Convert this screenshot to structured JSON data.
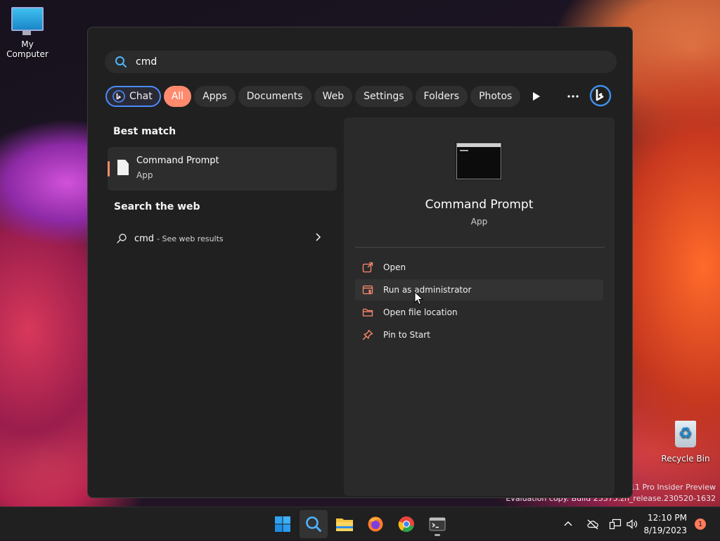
{
  "desktop": {
    "icons": [
      {
        "label": "My Computer"
      },
      {
        "label": "Recycle Bin"
      }
    ],
    "watermark": {
      "line1": "11 Pro Insider Preview",
      "line2": "Evaluation copy. Build 25375.zn_release.230520-1632"
    }
  },
  "search": {
    "query": "cmd",
    "filters": [
      {
        "label": "Chat"
      },
      {
        "label": "All"
      },
      {
        "label": "Apps"
      },
      {
        "label": "Documents"
      },
      {
        "label": "Web"
      },
      {
        "label": "Settings"
      },
      {
        "label": "Folders"
      },
      {
        "label": "Photos"
      }
    ],
    "best_match_heading": "Best match",
    "best_match": {
      "title": "Command Prompt",
      "subtitle": "App"
    },
    "web_heading": "Search the web",
    "web_result": {
      "query": "cmd",
      "suffix": "- See web results"
    }
  },
  "details": {
    "title": "Command Prompt",
    "subtitle": "App",
    "actions": [
      {
        "label": "Open"
      },
      {
        "label": "Run as administrator"
      },
      {
        "label": "Open file location"
      },
      {
        "label": "Pin to Start"
      }
    ]
  },
  "taskbar": {
    "time": "12:10 PM",
    "date": "8/19/2023",
    "notification_count": "1"
  },
  "colors": {
    "accent": "#ff8a6e",
    "chat_border": "#4a8cff",
    "panel_bg": "#202020"
  }
}
